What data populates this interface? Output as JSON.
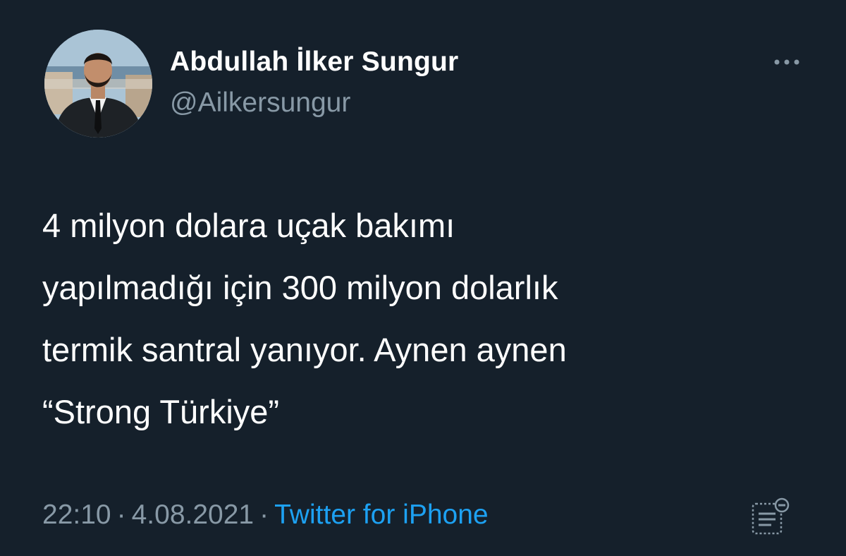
{
  "author": {
    "display_name": "Abdullah İlker Sungur",
    "handle": "@Ailkersungur"
  },
  "tweet": {
    "text": "4 milyon dolara uçak bakımı\nyapılmadığı için 300 milyon dolarlık\ntermik santral yanıyor. Aynen aynen\n“Strong Türkiye”",
    "time": "22:10",
    "separator": "·",
    "date": "4.08.2021",
    "source": "Twitter for iPhone"
  },
  "icons": {
    "more": "more-options-icon",
    "analytics": "tweet-analytics-icon",
    "avatar": "profile-photo"
  },
  "colors": {
    "background": "#15202b",
    "primary_text": "#ffffff",
    "secondary_text": "#8899a6",
    "accent": "#1da1f2"
  }
}
